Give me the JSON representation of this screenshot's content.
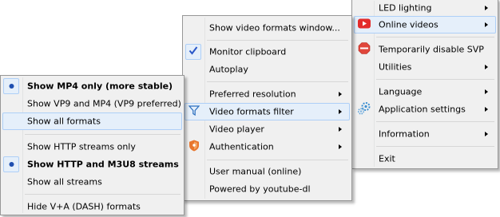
{
  "menu_right": {
    "items": [
      {
        "label": "LED lighting"
      },
      {
        "label": "Online videos"
      },
      {
        "label": "Temporarily disable SVP"
      },
      {
        "label": "Utilities"
      },
      {
        "label": "Language"
      },
      {
        "label": "Application settings"
      },
      {
        "label": "Information"
      },
      {
        "label": "Exit"
      }
    ]
  },
  "menu_middle": {
    "items": [
      {
        "label": "Show video formats window..."
      },
      {
        "label": "Monitor clipboard"
      },
      {
        "label": "Autoplay"
      },
      {
        "label": "Preferred resolution"
      },
      {
        "label": "Video formats filter"
      },
      {
        "label": "Video player"
      },
      {
        "label": "Authentication"
      },
      {
        "label": "User manual (online)"
      },
      {
        "label": "Powered by youtube-dl"
      }
    ]
  },
  "menu_left": {
    "items": [
      {
        "label": "Show MP4 only (more stable)"
      },
      {
        "label": "Show VP9 and MP4 (VP9 preferred)"
      },
      {
        "label": "Show all formats"
      },
      {
        "label": "Show HTTP streams only"
      },
      {
        "label": "Show HTTP and M3U8 streams"
      },
      {
        "label": "Show all streams"
      },
      {
        "label": "Hide V+A (DASH) formats"
      }
    ]
  },
  "colors": {
    "highlight_bg": "#e5effa",
    "highlight_border": "#aecff7",
    "youtube_red": "#e32b2b",
    "stop_red": "#e0463b",
    "gear_blue": "#3d8fd1",
    "shield_orange": "#e8762d",
    "radio_blue": "#1f4fb0",
    "check_blue": "#2a57c8"
  },
  "icons": [
    "play-video-icon",
    "stop-sign-icon",
    "gears-icon",
    "checkmark-icon",
    "funnel-filter-icon",
    "shield-icon",
    "radio-dot-icon"
  ]
}
